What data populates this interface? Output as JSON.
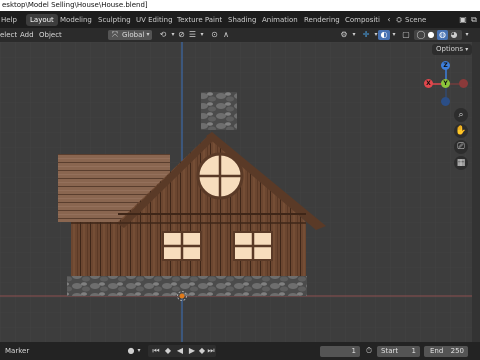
{
  "titlebar": {
    "text": "esktop\\Model Selling\\House\\House.blend]"
  },
  "topbar": {
    "menu_help": "Help",
    "tabs": [
      "Layout",
      "Modeling",
      "Sculpting",
      "UV Editing",
      "Texture Paint",
      "Shading",
      "Animation",
      "Rendering",
      "Compositi"
    ],
    "active_tab": "Layout",
    "scene_label": "Scene"
  },
  "header": {
    "menus": [
      "elect",
      "Add",
      "Object"
    ],
    "orientation": "Global"
  },
  "viewport": {
    "options_label": "Options",
    "gizmo": {
      "z": "Z",
      "y": "Y",
      "x": "X"
    },
    "colors": {
      "x_axis": "#e0474c",
      "y_axis": "#8cc43a",
      "z_axis": "#3d7fdc",
      "grid_line": "#a85656",
      "origin": "#e07a1a"
    }
  },
  "timeline": {
    "marker_label": "Marker",
    "current_frame": "1",
    "start_label": "Start",
    "start_value": "1",
    "end_label": "End",
    "end_value": "250"
  }
}
